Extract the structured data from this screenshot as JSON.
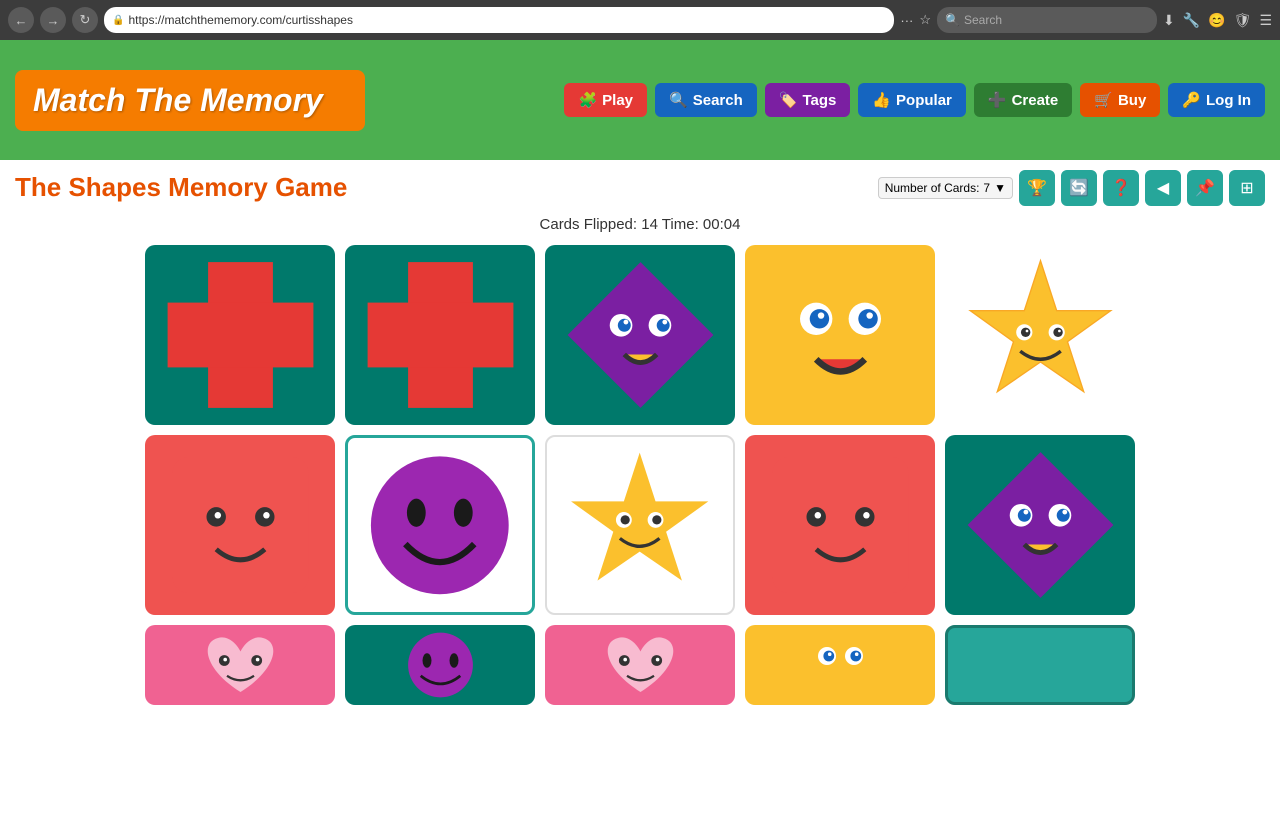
{
  "browser": {
    "url": "https://matchthememory.com/curtisshapes",
    "search_placeholder": "Search"
  },
  "header": {
    "logo": "Match The Memory",
    "nav": [
      {
        "label": "Play",
        "icon": "🧩",
        "class": "btn-play"
      },
      {
        "label": "Search",
        "icon": "🔍",
        "class": "btn-search"
      },
      {
        "label": "Tags",
        "icon": "🏷️",
        "class": "btn-tags"
      },
      {
        "label": "Popular",
        "icon": "👍",
        "class": "btn-popular"
      },
      {
        "label": "Create",
        "icon": "➕",
        "class": "btn-create"
      },
      {
        "label": "Buy",
        "icon": "🛒",
        "class": "btn-buy"
      },
      {
        "label": "Log In",
        "icon": "🔑",
        "class": "btn-login"
      }
    ]
  },
  "game": {
    "title": "The Shapes Memory Game",
    "num_cards_label": "Number of Cards:",
    "num_cards_value": "7",
    "stats": "Cards Flipped: 14  Time: 00:04",
    "toolbar_icons": [
      "trophy",
      "refresh",
      "help",
      "back",
      "pin",
      "grid"
    ]
  }
}
